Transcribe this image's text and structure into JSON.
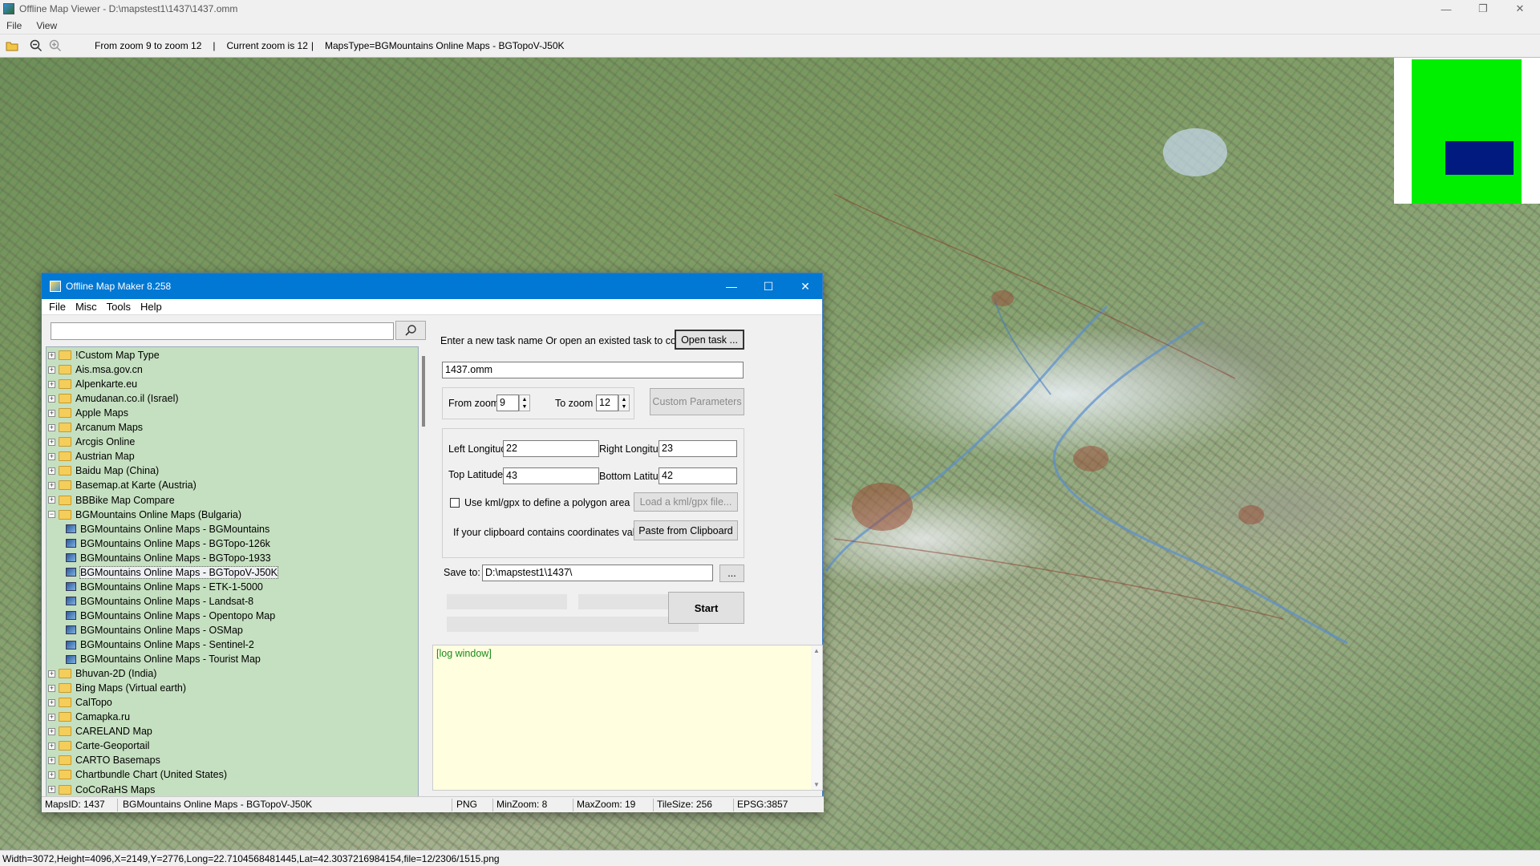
{
  "app": {
    "title": "Offline Map Viewer - D:\\mapstest1\\1437\\1437.omm",
    "menu": [
      "File",
      "View"
    ],
    "window_controls": {
      "minimize": "—",
      "restore": "❐",
      "close": "✕"
    }
  },
  "toolbar": {
    "zoom_range": "From zoom 9 to zoom 12",
    "sep1": "|",
    "current_zoom": "Current zoom is 12",
    "sep2": "|",
    "maps_type": "MapsType=BGMountains Online Maps - BGTopoV-J50K"
  },
  "status_bar": {
    "text": "Width=3072,Height=4096,X=2149,Y=2776,Long=22.7104568481445,Lat=42.3037216984154,file=12/2306/1515.png"
  },
  "minimap": {
    "field_color": "#00ee00",
    "viewport_color": "#001a80"
  },
  "dialog": {
    "title": "Offline Map Maker 8.258",
    "menu": [
      "File",
      "Misc",
      "Tools",
      "Help"
    ],
    "search": {
      "value": ""
    },
    "tree": [
      {
        "label": "!Custom Map Type",
        "type": "folder"
      },
      {
        "label": "Ais.msa.gov.cn",
        "type": "folder"
      },
      {
        "label": "Alpenkarte.eu",
        "type": "folder"
      },
      {
        "label": "Amudanan.co.il (Israel)",
        "type": "folder"
      },
      {
        "label": "Apple Maps",
        "type": "folder"
      },
      {
        "label": "Arcanum Maps",
        "type": "folder"
      },
      {
        "label": "Arcgis Online",
        "type": "folder"
      },
      {
        "label": "Austrian Map",
        "type": "folder"
      },
      {
        "label": "Baidu Map (China)",
        "type": "folder"
      },
      {
        "label": "Basemap.at Karte (Austria)",
        "type": "folder"
      },
      {
        "label": "BBBike Map Compare",
        "type": "folder"
      },
      {
        "label": "BGMountains Online Maps (Bulgaria)",
        "type": "folder-open"
      },
      {
        "label": "BGMountains Online Maps - BGMountains",
        "type": "map"
      },
      {
        "label": "BGMountains Online Maps - BGTopo-126k",
        "type": "map"
      },
      {
        "label": "BGMountains Online Maps - BGTopo-1933",
        "type": "map"
      },
      {
        "label": "BGMountains Online Maps - BGTopoV-J50K",
        "type": "map",
        "selected": true
      },
      {
        "label": "BGMountains Online Maps - ETK-1-5000",
        "type": "map"
      },
      {
        "label": "BGMountains Online Maps - Landsat-8",
        "type": "map"
      },
      {
        "label": "BGMountains Online Maps - Opentopo Map",
        "type": "map"
      },
      {
        "label": "BGMountains Online Maps - OSMap",
        "type": "map"
      },
      {
        "label": "BGMountains Online Maps - Sentinel-2",
        "type": "map"
      },
      {
        "label": "BGMountains Online Maps - Tourist Map",
        "type": "map"
      },
      {
        "label": "Bhuvan-2D (India)",
        "type": "folder"
      },
      {
        "label": "Bing Maps (Virtual earth)",
        "type": "folder"
      },
      {
        "label": "CalTopo",
        "type": "folder"
      },
      {
        "label": "Camapka.ru",
        "type": "folder"
      },
      {
        "label": "CARELAND Map",
        "type": "folder"
      },
      {
        "label": "Carte-Geoportail",
        "type": "folder"
      },
      {
        "label": "CARTO Basemaps",
        "type": "folder"
      },
      {
        "label": "Chartbundle Chart (United States)",
        "type": "folder"
      },
      {
        "label": "CoCoRaHS Maps",
        "type": "folder"
      }
    ],
    "task": {
      "prompt": "Enter a new task name Or open an existed task to continue:",
      "open_btn": "Open task ...",
      "name": "1437.omm"
    },
    "zoom": {
      "from_label": "From zoom",
      "from_value": "9",
      "to_label": "To zoom",
      "to_value": "12",
      "custom_btn": "Custom Parameters"
    },
    "coords": {
      "left_lon_label": "Left Longitude",
      "left_lon": "22",
      "right_lon_label": "Right Longitude",
      "right_lon": "23",
      "top_lat_label": "Top Latitude",
      "top_lat": "43",
      "bottom_lat_label": "Bottom Latitude",
      "bottom_lat": "42",
      "kml_label": "Use kml/gpx to define a polygon area",
      "kml_btn": "Load a kml/gpx file...",
      "clip_label": "If your clipboard contains coordinates values:",
      "clip_btn": "Paste from Clipboard"
    },
    "save": {
      "label": "Save to:",
      "path": "D:\\mapstest1\\1437\\",
      "browse": "..."
    },
    "start_btn": "Start",
    "log": {
      "text": "[log window]"
    },
    "status": {
      "maps_id": "MapsID: 1437",
      "name": "BGMountains Online Maps - BGTopoV-J50K",
      "format": "PNG",
      "min_zoom": "MinZoom: 8",
      "max_zoom": "MaxZoom: 19",
      "tile_size": "TileSize: 256",
      "epsg": "EPSG:3857"
    }
  }
}
